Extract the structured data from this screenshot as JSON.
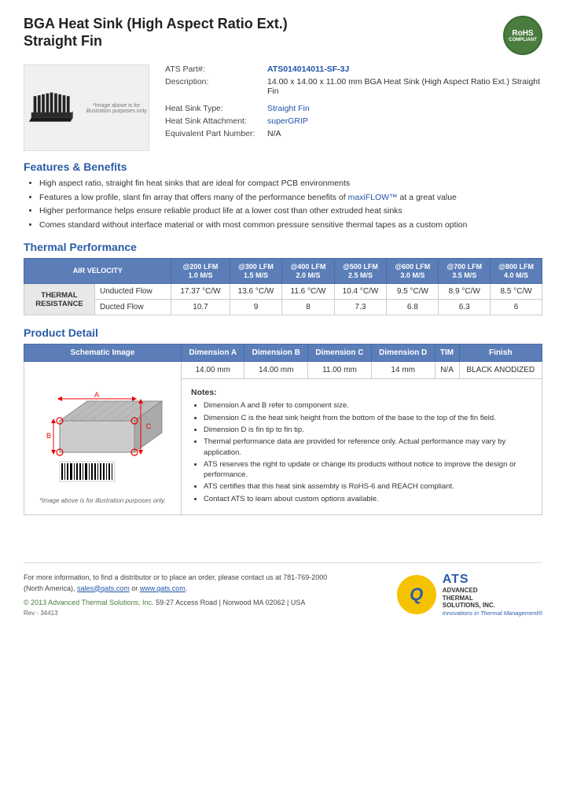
{
  "page": {
    "title1": "BGA Heat Sink (High Aspect Ratio Ext.)",
    "title2": "Straight Fin"
  },
  "rohs": {
    "line1": "RoHS",
    "line2": "COMPLIANT"
  },
  "specs": {
    "ats_part_label": "ATS Part#:",
    "ats_part_value": "ATS014014011-SF-3J",
    "description_label": "Description:",
    "description_value": "14.00 x 14.00 x 11.00 mm BGA Heat Sink (High Aspect Ratio Ext.) Straight Fin",
    "heat_sink_type_label": "Heat Sink Type:",
    "heat_sink_type_value": "Straight Fin",
    "heat_sink_attachment_label": "Heat Sink Attachment:",
    "heat_sink_attachment_value": "superGRIP",
    "equivalent_part_label": "Equivalent Part Number:",
    "equivalent_part_value": "N/A"
  },
  "image_note": "*Image above is for illustration purposes only",
  "features": {
    "title": "Features & Benefits",
    "items": [
      "High aspect ratio, straight fin heat sinks that are ideal for compact PCB environments",
      "Features a low profile, slant fin array that offers many of the performance benefits of maxiFLOW™ at a great value",
      "Higher performance helps ensure reliable product life at a lower cost than other extruded heat sinks",
      "Comes standard without interface material or with most common pressure sensitive thermal tapes as a custom option"
    ],
    "maxiflow_link": "maxiFLOW™"
  },
  "thermal": {
    "title": "Thermal Performance",
    "table": {
      "col_header": "AIR VELOCITY",
      "cols": [
        {
          "speed": "@200 LFM",
          "ms": "1.0 M/S"
        },
        {
          "speed": "@300 LFM",
          "ms": "1.5 M/S"
        },
        {
          "speed": "@400 LFM",
          "ms": "2.0 M/S"
        },
        {
          "speed": "@500 LFM",
          "ms": "2.5 M/S"
        },
        {
          "speed": "@600 LFM",
          "ms": "3.0 M/S"
        },
        {
          "speed": "@700 LFM",
          "ms": "3.5 M/S"
        },
        {
          "speed": "@800 LFM",
          "ms": "4.0 M/S"
        }
      ],
      "row_header": "THERMAL RESISTANCE",
      "rows": [
        {
          "label": "Unducted Flow",
          "values": [
            "17.37 °C/W",
            "13.6 °C/W",
            "11.6 °C/W",
            "10.4 °C/W",
            "9.5 °C/W",
            "8.9 °C/W",
            "8.5 °C/W"
          ]
        },
        {
          "label": "Ducted Flow",
          "values": [
            "10.7",
            "9",
            "8",
            "7.3",
            "6.8",
            "6.3",
            "6"
          ]
        }
      ]
    }
  },
  "product_detail": {
    "title": "Product Detail",
    "table_headers": [
      "Schematic Image",
      "Dimension A",
      "Dimension B",
      "Dimension C",
      "Dimension D",
      "TIM",
      "Finish"
    ],
    "dimensions": {
      "a": "14.00 mm",
      "b": "14.00 mm",
      "c": "11.00 mm",
      "d": "14 mm",
      "tim": "N/A",
      "finish": "BLACK ANODIZED"
    },
    "notes_title": "Notes:",
    "notes": [
      "Dimension A and B refer to component size.",
      "Dimension C is the heat sink height from the bottom of the base to the top of the fin field.",
      "Dimension D is fin tip to fin tip.",
      "Thermal performance data are provided for reference only. Actual performance may vary by application.",
      "ATS reserves the right to update or change its products without notice to improve the design or performance.",
      "ATS certifies that this heat sink assembly is RoHS-6 and REACH compliant.",
      "Contact ATS to learn about custom options available."
    ],
    "schematic_note": "*Image above is for illustration purposes only."
  },
  "footer": {
    "contact_text": "For more information, to find a distributor or to place an order, please contact us at 781-769-2000 (North America),",
    "email": "sales@qats.com",
    "or_text": "or",
    "website": "www.qats.com",
    "copyright": "© 2013 Advanced Thermal Solutions, Inc.",
    "address": "59-27 Access Road  |  Norwood MA  02062  |  USA",
    "rev": "Rev - 34413"
  },
  "ats_logo": {
    "letter": "Q",
    "name": "ATS",
    "line1": "ADVANCED",
    "line2": "THERMAL",
    "line3": "SOLUTIONS, INC.",
    "tagline": "Innovations in Thermal Management®"
  }
}
